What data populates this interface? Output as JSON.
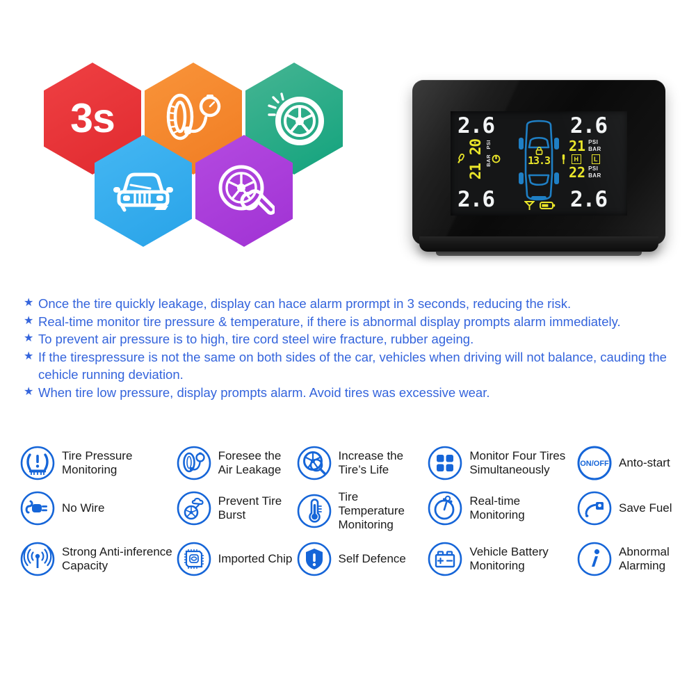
{
  "hexagons": [
    {
      "id": "response-time",
      "label": "3s",
      "icon": "text-3s",
      "color": "#e02a2f"
    },
    {
      "id": "tire-gauge",
      "label": "",
      "icon": "tire-pressure-gauge-icon",
      "color": "#f07c22"
    },
    {
      "id": "wheel-shine",
      "label": "",
      "icon": "alloy-wheel-icon",
      "color": "#12a37d"
    },
    {
      "id": "car-front",
      "label": "",
      "icon": "car-front-icon",
      "color": "#28a3e8"
    },
    {
      "id": "wheel-wrench",
      "label": "",
      "icon": "wheel-wrench-icon",
      "color": "#a032d4"
    }
  ],
  "device": {
    "name": "tpms-display-unit",
    "lcd": {
      "front_left": {
        "pressure": "2.6",
        "temp": "20",
        "unit_top": "PSI",
        "unit_bottom": "BAR"
      },
      "front_right": {
        "pressure": "2.6",
        "temp": "21",
        "unit_top": "PSI",
        "unit_bottom": "BAR"
      },
      "rear_left": {
        "pressure": "2.6",
        "temp": "21",
        "unit_top": "PSI",
        "unit_bottom": "BAR"
      },
      "rear_right": {
        "pressure": "2.6",
        "temp": "22",
        "unit_top": "PSI",
        "unit_bottom": "BAR"
      },
      "voltage": "13.3",
      "indicator_high": "H",
      "indicator_low": "L",
      "colors": {
        "segment_white": "#f2f4f5",
        "segment_yellow": "#e9e52a",
        "car_blue": "#1f7fc4"
      },
      "icons": [
        "signal-antenna-icon",
        "battery-icon",
        "lock-icon",
        "wrench-icon",
        "key-icon"
      ]
    }
  },
  "bullets": [
    "Once the tire quickly leakage, display can hace alarm prormpt in 3 seconds, reducing the risk.",
    "Real-time monitor tire pressure & temperature, if there is abnormal display prompts alarm immediately.",
    "To prevent air pressure is to high, tire cord steel wire fracture, rubber ageing.",
    "If the tirespressure is not the same on both sides of the car, vehicles when driving will not balance, cauding the cehicle running deviation.",
    "When tire low pressure, display prompts alarm. Avoid tires was excessive wear."
  ],
  "bullet_marker": "★",
  "bullet_color": "#3464dc",
  "features": [
    [
      {
        "label": "Tire Pressure Monitoring",
        "icon": "tire-pressure-warning-icon"
      },
      {
        "label": "Foresee the Air Leakage",
        "icon": "tire-gauge-icon"
      },
      {
        "label": "Increase the Tire’s Life",
        "icon": "wheel-magnifier-icon"
      },
      {
        "label": "Monitor Four Tires Simultaneously",
        "icon": "four-squares-icon"
      },
      {
        "label": "Anto-start",
        "icon": "on-off-icon",
        "icon_text": "ON/OFF"
      }
    ],
    [
      {
        "label": "No Wire",
        "icon": "unplugged-cable-icon"
      },
      {
        "label": "Prevent Tire Burst",
        "icon": "tire-burst-icon"
      },
      {
        "label": "Tire Temperature Monitoring",
        "icon": "thermometer-icon"
      },
      {
        "label": "Real-time Monitoring",
        "icon": "stopwatch-icon"
      },
      {
        "label": "Save Fuel",
        "icon": "fuel-nozzle-icon"
      }
    ],
    [
      {
        "label": "Strong Anti-inference Capacity",
        "icon": "signal-waves-icon"
      },
      {
        "label": "Imported Chip",
        "icon": "microchip-icon"
      },
      {
        "label": "Self Defence",
        "icon": "shield-exclamation-icon"
      },
      {
        "label": "Vehicle Battery Monitoring",
        "icon": "car-battery-icon"
      },
      {
        "label": "Abnormal Alarming",
        "icon": "info-italic-icon"
      }
    ]
  ],
  "feature_accent": "#1565d8"
}
